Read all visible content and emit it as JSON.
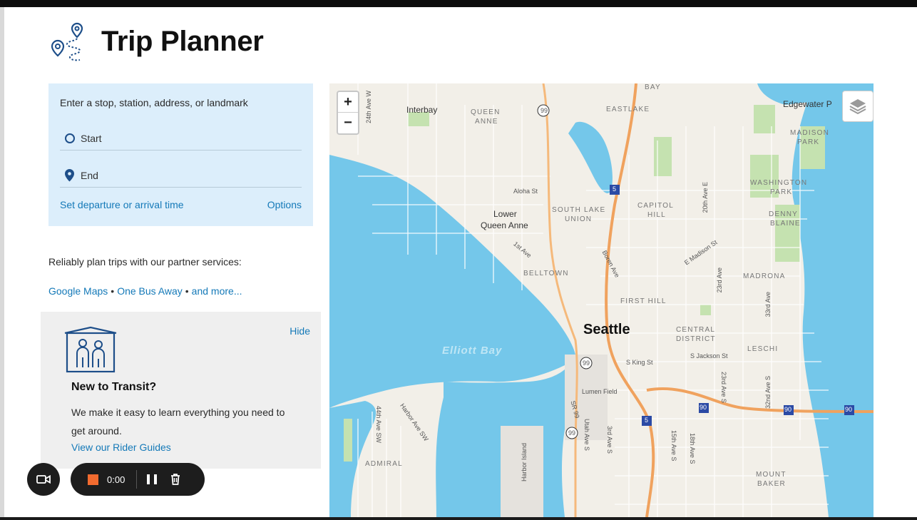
{
  "header": {
    "title": "Trip Planner"
  },
  "search": {
    "prompt": "Enter a stop, station, address, or landmark",
    "start_placeholder": "Start",
    "end_placeholder": "End",
    "departure_link": "Set departure or arrival time",
    "options_link": "Options"
  },
  "partners": {
    "text": "Reliably plan trips with our partner services:",
    "links": [
      "Google Maps",
      "One Bus Away",
      "and more..."
    ],
    "separator": "•"
  },
  "transit_card": {
    "hide": "Hide",
    "title": "New to Transit?",
    "body": "We make it easy to learn everything you need to get around.",
    "link": "View our Rider Guides"
  },
  "recorder": {
    "time": "0:00"
  },
  "map": {
    "zoom_in": "+",
    "zoom_out": "−",
    "city": "Seattle",
    "water": "Elliott Bay",
    "neighborhoods": [
      "Interbay",
      "QUEEN",
      "ANNE",
      "EASTLAKE",
      "Edgewater P",
      "MADISON",
      "PARK",
      "WASHINGTON",
      "PARK",
      "CAPITOL",
      "HILL",
      "DENNY",
      "BLAINE",
      "Lower",
      "Queen Anne",
      "SOUTH LAKE",
      "UNION",
      "BELLTOWN",
      "MADRONA",
      "FIRST HILL",
      "CENTRAL",
      "DISTRICT",
      "LESCHI",
      "Lumen Field",
      "ADMIRAL",
      "MOUNT",
      "BAKER",
      "BAY"
    ],
    "streets": [
      "Aloha St",
      "1st Ave",
      "Boren Ave",
      "E Madison St",
      "23rd Ave",
      "20th Ave E",
      "33rd Ave",
      "S Jackson St",
      "S King St",
      "SR 99",
      "Utah Ave S",
      "3rd Ave S",
      "15th Ave S",
      "18th Ave S",
      "23rd Ave S",
      "32nd Ave S",
      "Harbor Ave SW",
      "44th Ave SW",
      "Harbor Island",
      "24th Ave W"
    ],
    "shields": [
      "99",
      "5",
      "90"
    ],
    "colors": {
      "water": "#74c7ea",
      "land": "#f2efe8",
      "park": "#c5e2b0",
      "highway": "#f0a25e"
    }
  }
}
